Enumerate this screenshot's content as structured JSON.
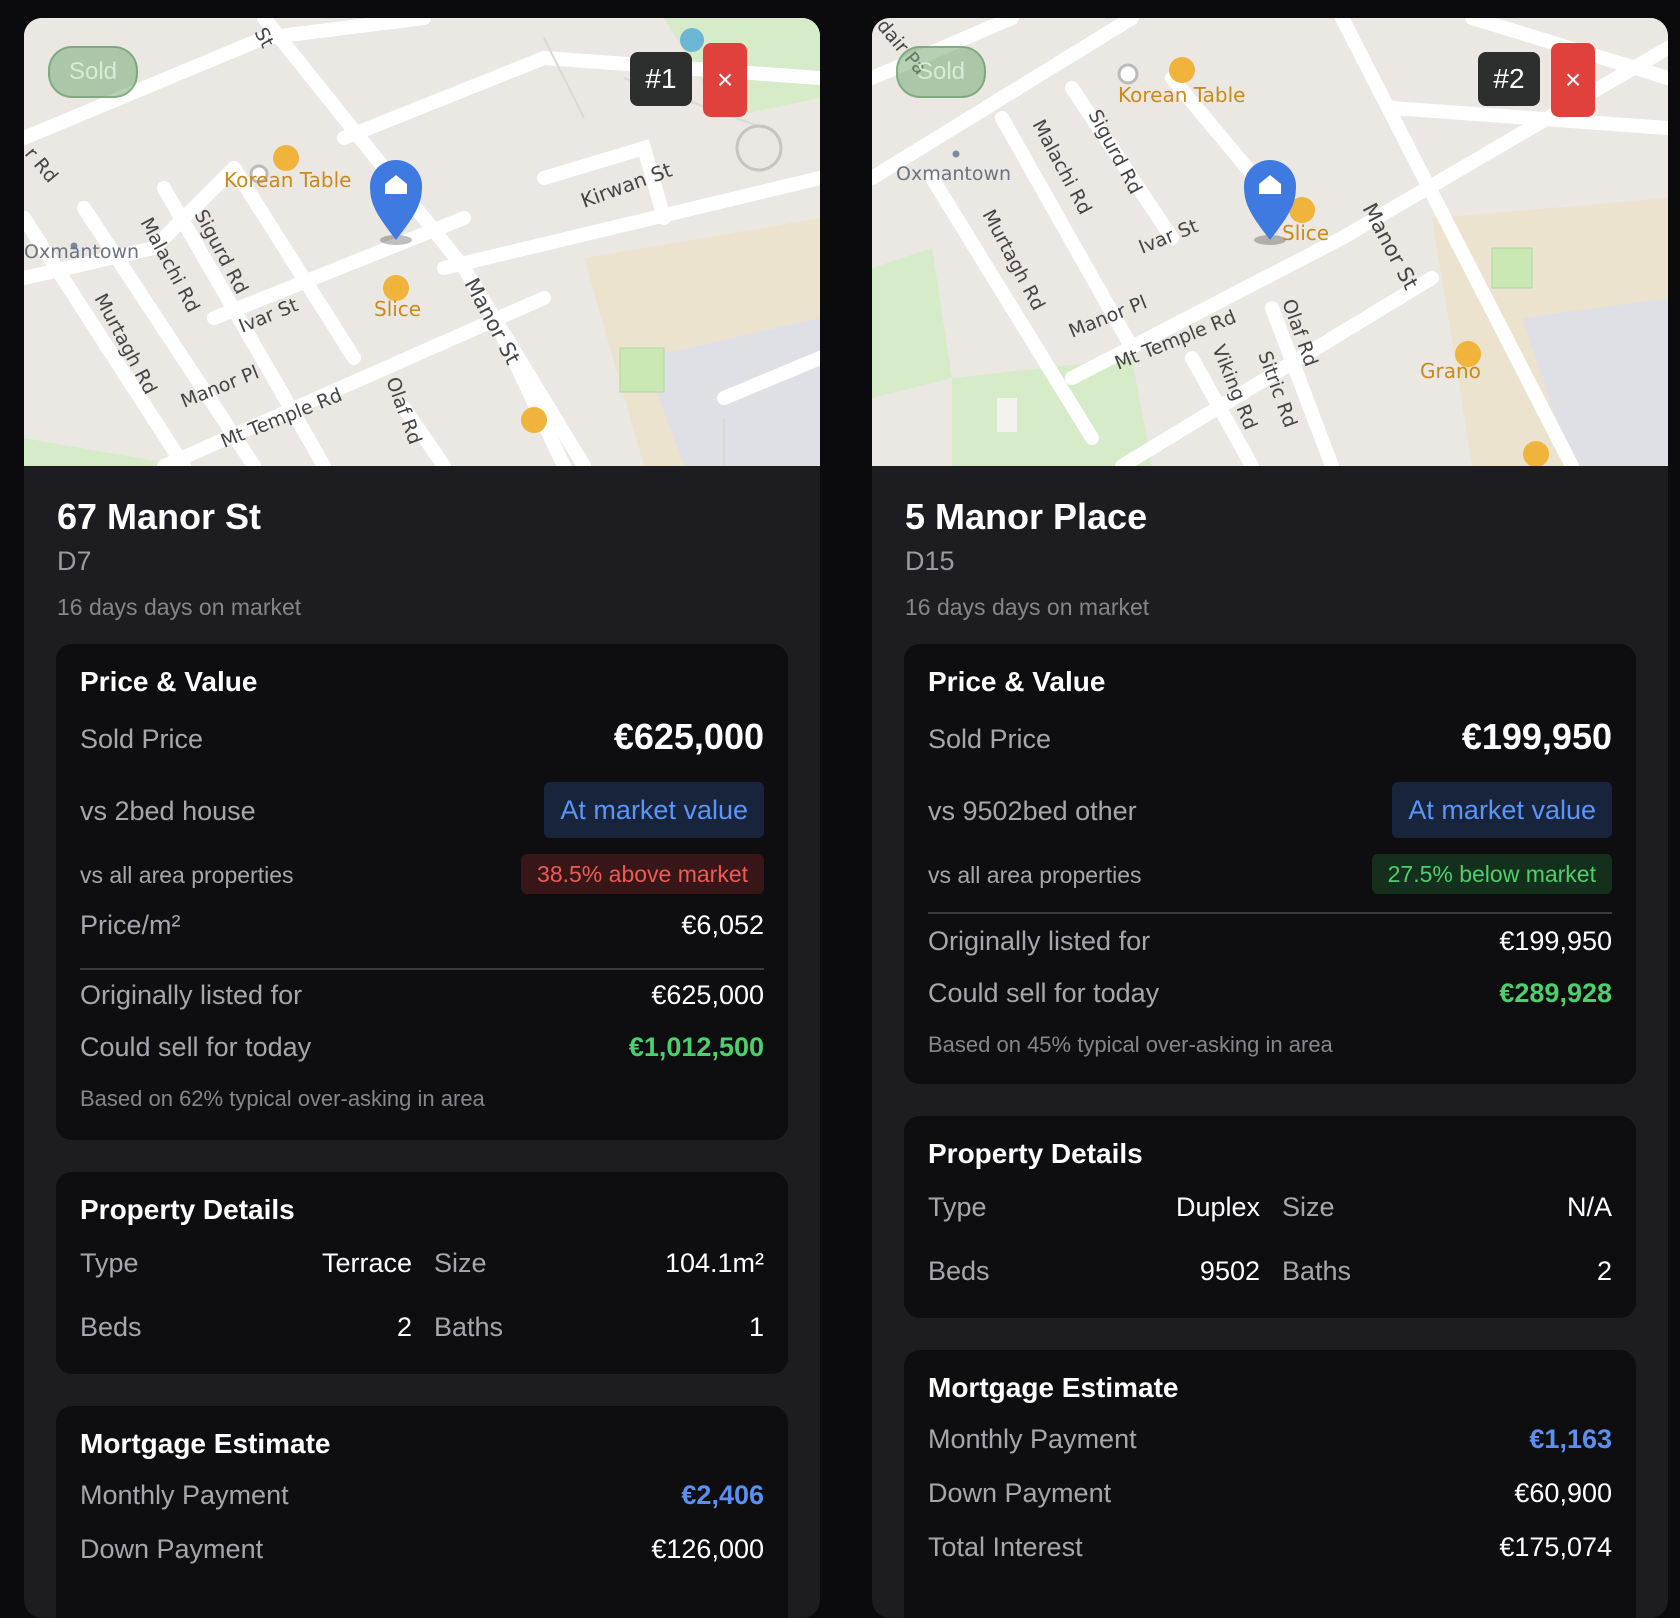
{
  "cards": [
    {
      "sold_badge": "Sold",
      "rank": "#1",
      "close": "×",
      "title": "67 Manor St",
      "district": "D7",
      "days_on_market": "16 days days on market",
      "map_labels": {
        "korean_table": "Korean Table",
        "slice": "Slice",
        "oxmantown": "Oxmantown",
        "kirwan": "Kirwan St",
        "malachi": "Malachi Rd",
        "sigurd": "Sigurd Rd",
        "ivar": "Ivar St",
        "murtagh": "Murtagh Rd",
        "manor_pl": "Manor Pl",
        "mt_temple": "Mt Temple Rd",
        "olaf": "Olaf Rd",
        "manor_st": "Manor St",
        "rd": "r Rd",
        "st": "St"
      },
      "price_value": {
        "title": "Price & Value",
        "sold_price_label": "Sold Price",
        "sold_price": "€625,000",
        "vs_type_label": "vs 2bed house",
        "vs_type_value": "At market value",
        "vs_area_label": "vs all area properties",
        "vs_area_value": "38.5% above market",
        "price_m2_label": "Price/m²",
        "price_m2": "€6,052",
        "listed_label": "Originally listed for",
        "listed": "€625,000",
        "could_sell_label": "Could sell for today",
        "could_sell": "€1,012,500",
        "note": "Based on 62% typical over-asking in area"
      },
      "details": {
        "title": "Property Details",
        "type_label": "Type",
        "type": "Terrace",
        "size_label": "Size",
        "size": "104.1m²",
        "beds_label": "Beds",
        "beds": "2",
        "baths_label": "Baths",
        "baths": "1"
      },
      "mortgage": {
        "title": "Mortgage Estimate",
        "monthly_label": "Monthly Payment",
        "monthly": "€2,406",
        "down_label": "Down Payment",
        "down": "€126,000"
      }
    },
    {
      "sold_badge": "Sold",
      "rank": "#2",
      "close": "×",
      "title": "5 Manor Place",
      "district": "D15",
      "days_on_market": "16 days days on market",
      "map_labels": {
        "korean_table": "Korean Table",
        "slice": "Slice",
        "oxmantown": "Oxmantown",
        "malachi": "Malachi Rd",
        "sigurd": "Sigurd Rd",
        "ivar": "Ivar St",
        "murtagh": "Murtagh Rd",
        "manor_pl": "Manor Pl",
        "mt_temple": "Mt Temple Rd",
        "olaf": "Olaf Rd",
        "viking": "Viking Rd",
        "sitric": "Sitric Rd",
        "manor_st": "Manor St",
        "grano": "Grano",
        "dair": "dair Pa"
      },
      "price_value": {
        "title": "Price & Value",
        "sold_price_label": "Sold Price",
        "sold_price": "€199,950",
        "vs_type_label": "vs 9502bed other",
        "vs_type_value": "At market value",
        "vs_area_label": "vs all area properties",
        "vs_area_value": "27.5% below market",
        "listed_label": "Originally listed for",
        "listed": "€199,950",
        "could_sell_label": "Could sell for today",
        "could_sell": "€289,928",
        "note": "Based on 45% typical over-asking in area"
      },
      "details": {
        "title": "Property Details",
        "type_label": "Type",
        "type": "Duplex",
        "size_label": "Size",
        "size": "N/A",
        "beds_label": "Beds",
        "beds": "9502",
        "baths_label": "Baths",
        "baths": "2"
      },
      "mortgage": {
        "title": "Mortgage Estimate",
        "monthly_label": "Monthly Payment",
        "monthly": "€1,163",
        "down_label": "Down Payment",
        "down": "€60,900",
        "interest_label": "Total Interest",
        "interest": "€175,074"
      }
    }
  ]
}
